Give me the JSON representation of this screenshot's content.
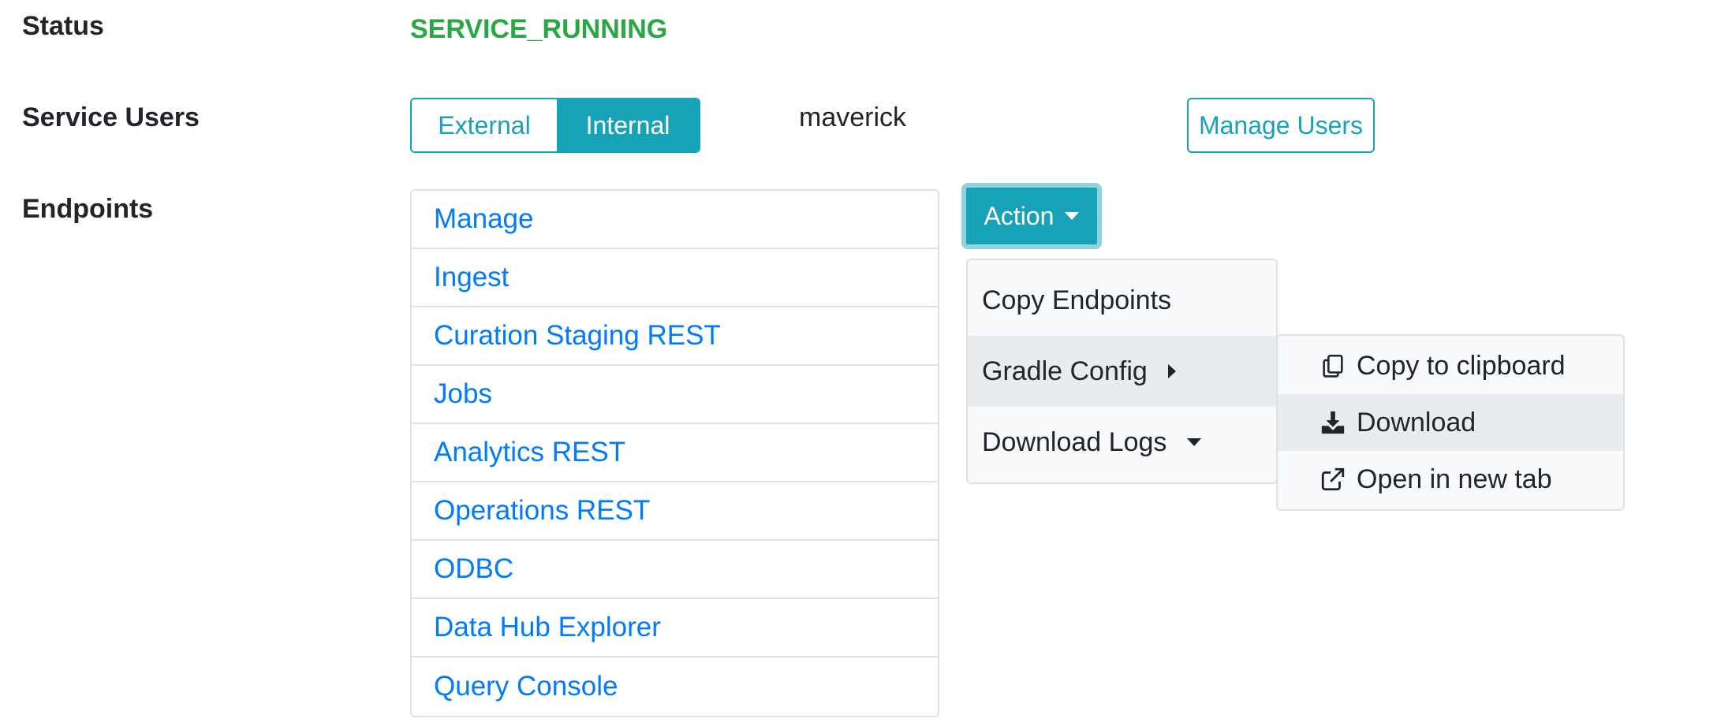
{
  "status": {
    "label": "Status",
    "value": "SERVICE_RUNNING",
    "value_color": "#28a745"
  },
  "service_users": {
    "label": "Service Users",
    "toggle": {
      "options": [
        "External",
        "Internal"
      ],
      "selected": "Internal"
    },
    "username": "maverick",
    "manage_button": "Manage Users"
  },
  "endpoints": {
    "label": "Endpoints",
    "items": [
      "Manage",
      "Ingest",
      "Curation Staging REST",
      "Jobs",
      "Analytics REST",
      "Operations REST",
      "ODBC",
      "Data Hub Explorer",
      "Query Console"
    ]
  },
  "action_menu": {
    "button_label": "Action",
    "items": [
      {
        "label": "Copy Endpoints"
      },
      {
        "label": "Gradle Config",
        "has_submenu": true
      },
      {
        "label": "Download Logs",
        "has_dropdown": true
      }
    ],
    "submenu": {
      "items": [
        {
          "label": "Copy to clipboard",
          "icon": "copy-icon"
        },
        {
          "label": "Download",
          "icon": "download-icon"
        },
        {
          "label": "Open in new tab",
          "icon": "external-link-icon"
        }
      ]
    }
  },
  "colors": {
    "accent": "#17a2b8",
    "link": "#007bff",
    "success": "#28a745"
  }
}
